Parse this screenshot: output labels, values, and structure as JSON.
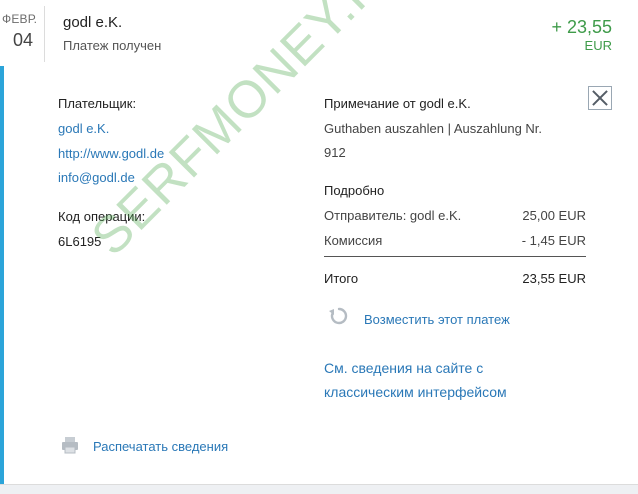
{
  "header": {
    "month": "ФЕВР.",
    "day": "04",
    "merchant": "godl e.K.",
    "status": "Платеж получен",
    "amount": "+ 23,55",
    "currency": "EUR"
  },
  "payer": {
    "label": "Плательщик:",
    "name": "godl e.K.",
    "website": "http://www.godl.de",
    "email": "info@godl.de"
  },
  "operation": {
    "label": "Код операции:",
    "code": "6L6195"
  },
  "note": {
    "label": "Примечание от godl e.K.",
    "text_line1": "Guthaben auszahlen | Auszahlung Nr.",
    "text_line2": "912"
  },
  "details": {
    "label": "Подробно",
    "sender_label": "Отправитель: godl e.K.",
    "sender_value": "25,00 EUR",
    "fee_label": "Комиссия",
    "fee_value": "- 1,45 EUR",
    "total_label": "Итого",
    "total_value": "23,55 EUR"
  },
  "actions": {
    "refund": "Возместить этот платеж",
    "classic_line1": "См. сведения на сайте с",
    "classic_line2": "классическим интерфейсом",
    "print": "Распечатать сведения"
  },
  "watermark": "SERFMONEY.RU",
  "colors": {
    "accent": "#2ba4d9",
    "amount": "#3f9b4a",
    "link": "#2a78b7"
  },
  "icons": [
    "close-icon",
    "refresh-icon",
    "printer-icon"
  ]
}
